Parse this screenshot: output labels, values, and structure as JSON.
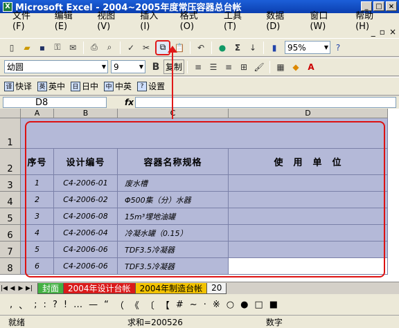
{
  "window": {
    "title": "Microsoft Excel - 2004~2005年度常压容器总台帐"
  },
  "menus": [
    "文件(F)",
    "编辑(E)",
    "视图(V)",
    "插入(I)",
    "格式(O)",
    "工具(T)",
    "数据(D)",
    "窗口(W)",
    "帮助(H)"
  ],
  "toolbar": {
    "zoom": "95%",
    "font": "幼圆",
    "size": "9",
    "bold": "B",
    "copy_label": "复制"
  },
  "translate_bar": [
    "快译",
    "英中",
    "日中",
    "中英",
    "设置"
  ],
  "formula_bar": {
    "cell_ref": "D8",
    "fx": "fx"
  },
  "columns": [
    "A",
    "B",
    "C",
    "D"
  ],
  "rows": [
    "1",
    "2",
    "3",
    "4",
    "5",
    "6",
    "7",
    "8"
  ],
  "table": {
    "headers": [
      "序号",
      "设计编号",
      "容器名称规格",
      "使　用　单　位"
    ],
    "rows": [
      [
        "1",
        "C4-2006-01",
        "废水槽"
      ],
      [
        "2",
        "C4-2006-02",
        "Φ500集（分）水器"
      ],
      [
        "3",
        "C4-2006-08",
        "15m³埋地油罐"
      ],
      [
        "4",
        "C4-2006-04",
        "冷凝水罐（0.15）"
      ],
      [
        "5",
        "C4-2006-06",
        "TDF3.5冷凝器"
      ],
      [
        "6",
        "C4-2006-06",
        "TDF3.5冷凝器"
      ]
    ]
  },
  "sheet_tabs": [
    "封面",
    "2004年设计台帐",
    "2004年制造台帐",
    "20"
  ],
  "symbols": [
    ",",
    "、",
    ";",
    ":",
    "?",
    "!",
    "…",
    "—",
    "“",
    "（",
    "《",
    "〔",
    "【",
    "#",
    "~",
    "·",
    "※",
    "○",
    "●",
    "□",
    "■"
  ],
  "status": {
    "ready": "就绪",
    "sum": "求和=200526",
    "mode": "数字"
  }
}
